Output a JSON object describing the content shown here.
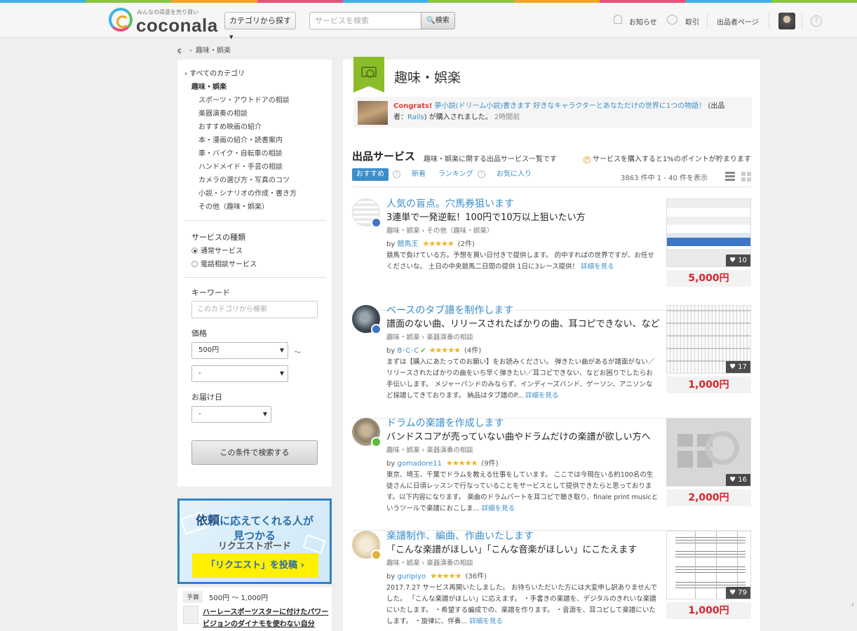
{
  "brand": {
    "strip_colors": [
      "#3eb3e4",
      "#8bc53f",
      "#f0a524",
      "#e84f7b",
      "#3eb3e4",
      "#8bc53f",
      "#f0a524",
      "#e84f7b",
      "#3eb3e4",
      "#8bc53f"
    ],
    "logo_tagline": "みんなの得意を売り買い",
    "logo_text": "coconala",
    "accent": "#3a8ec9",
    "price_color": "#d9232b",
    "category_color": "#8bbd2a"
  },
  "header": {
    "category_button": "カテゴリから探す ▾",
    "search": {
      "placeholder": "サービスを検索",
      "value": "",
      "button": "検索"
    },
    "nav": {
      "notifications": "お知らせ",
      "transactions": "取引",
      "seller_page": "出品者ページ",
      "help": "?"
    }
  },
  "breadcrumb": {
    "home_icon": "ç",
    "current": "趣味・娯楽"
  },
  "sidebar": {
    "all_categories": "すべてのカテゴリ",
    "current_category": "趣味・娯楽",
    "subcategories": [
      "スポーツ・アウトドアの相談",
      "楽器演奏の相談",
      "おすすめ映画の紹介",
      "本・漫画の紹介・読書案内",
      "車・バイク・自転車の相談",
      "ハンドメイド・手芸の相談",
      "カメラの選び方・写真のコツ",
      "小説・シナリオの作成・書き方",
      "その他（趣味・娯楽）"
    ],
    "service_type_label": "サービスの種類",
    "service_types": [
      {
        "label": "通常サービス",
        "selected": true
      },
      {
        "label": "電話相談サービス",
        "selected": false
      }
    ],
    "keyword_label": "キーワード",
    "keyword_placeholder": "このカテゴリから検索",
    "keyword_value": "",
    "price_label": "価格",
    "price_min": "500円",
    "tilde": "～",
    "price_max": "-",
    "delivery_label": "お届け日",
    "delivery_value": "-",
    "submit": "この条件で検索する"
  },
  "request_banner": {
    "line1_highlight": "依頼",
    "line1_rest": "に応えてくれる人が",
    "line1b": "見つかる",
    "line2": "リクエストボード",
    "button": "「リクエスト」を投稿 ›"
  },
  "request_card": {
    "budget_tag": "予算",
    "budget_value": "500円 ～ 1,000円",
    "title": "ハーレースポーツスターに付けたパワービジョンのダイナモを使わない自分"
  },
  "main": {
    "category_title": "趣味・娯楽",
    "congrats": {
      "label": "Congrats!",
      "service": "夢小説(ドリーム小説)書きます 好きなキャラクターとあなただけの世界に1つの物語！",
      "seller_prefix": "(出品者：",
      "seller": "Rails",
      "seller_suffix": ") が購入されました。",
      "time": "2時間前"
    },
    "section_title": "出品サービス",
    "section_subtitle": "趣味・娯楽に関する出品サービス一覧です",
    "points_icon": "P",
    "points_note": "サービスを購入すると1%のポイントが貯まります",
    "tabs": [
      "おすすめ",
      "新着",
      "ランキング",
      "お気に入り"
    ],
    "result_count": "3863 件中 1 - 40 件を表示"
  },
  "items": [
    {
      "title": "人気の盲点。穴馬券狙います",
      "subtitle": "3連単で一発逆転！100円で10万以上狙いたい方",
      "categories": "趣味・娯楽 › その他（趣味・娯楽）",
      "by": "by",
      "seller": "競馬王",
      "verified": "",
      "stars": "★★★★★",
      "rating": 4.5,
      "reviews": "(2件)",
      "description": "競馬で負けている方。予想を買い日付きで提供します。 的中すればの世界ですが、お任せくださいな。 土日の中央競馬二日間の提供 1日に3レース提供！",
      "more": "詳細を見る",
      "likes": "♥ 10",
      "price": "5,000円",
      "medal_color": "#3d76c4"
    },
    {
      "title": "ベースのタブ譜を制作します",
      "subtitle": "譜面のない曲、リリースされたばかりの曲、耳コピできない、など",
      "categories": "趣味・娯楽 › 楽器演奏の相談",
      "by": "by",
      "seller": "B･C･C",
      "verified": "✔",
      "stars": "★★★★★",
      "rating": 5,
      "reviews": "(4件)",
      "description": "まずは【購入にあたってのお願い】をお読みください。 弾きたい曲があるが譜面がない／リリースされたばかりの曲をいち早く弾きたい／耳コピできない、などお困りでしたらお手伝いします。 メジャーバンドのみならず、インディーズバンド、ゲーソン、アニソンなど採譜してきております。 納品はタブ譜のP...",
      "more": "詳細を見る",
      "likes": "♥ 17",
      "price": "1,000円",
      "medal_color": "#3d76c4"
    },
    {
      "title": "ドラムの楽譜を作成します",
      "subtitle": "バンドスコアが売っていない曲やドラムだけの楽譜が欲しい方へ",
      "categories": "趣味・娯楽 › 楽器演奏の相談",
      "by": "by",
      "seller": "gomadore11",
      "verified": "",
      "stars": "★★★★★",
      "rating": 5,
      "reviews": "(9件)",
      "description": "東京、埼玉、千葉でドラムを教える仕事をしています。 ここでは今現在いる約100名の生徒さんに日頃レッスンで行なっていることをサービスとして提供できたらと思っております。以下内容になります。 楽曲のドラムパートを耳コピで聴き取り、finale print musicというツールで楽譜におこしま...",
      "more": "詳細を見る",
      "likes": "♥ 16",
      "price": "2,000円",
      "medal_color": "#5bbd3c"
    },
    {
      "title": "楽譜制作、編曲、作曲いたします",
      "subtitle": "「こんな楽譜がほしい」「こんな音楽がほしい」にこたえます",
      "categories": "趣味・娯楽 › 楽器演奏の相談",
      "by": "by",
      "seller": "guripiyo",
      "verified": "",
      "stars": "★★★★★",
      "rating": 5,
      "reviews": "(36件)",
      "description": "2017.7.27 サービス再開いたしました。 お待ちいただいた方には大変申し訳ありませんでした。 「こんな楽譜がほしい」に応えます。 ・手書きの楽譜を、デジタルのきれいな楽譜にいたします。 ・希望する編成での、楽譜を作ります。 ・音源を、耳コピして楽譜にいたします。 ・旋律に、伴奏...",
      "more": "詳細を見る",
      "likes": "♥ 79",
      "price": "1,000円",
      "medal_color": "#e0b33a"
    }
  ]
}
